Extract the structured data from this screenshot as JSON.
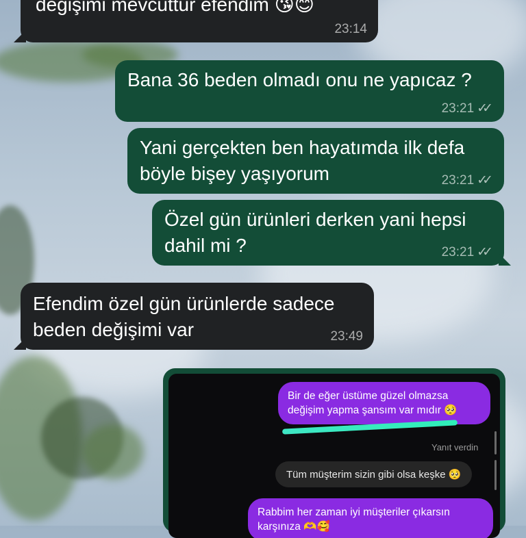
{
  "messages": [
    {
      "text": "değişimi mevcuttur efendim 😘😊",
      "time": "23:14"
    },
    {
      "text": "Bana 36 beden olmadı onu ne yapıcaz ?",
      "time": "23:21",
      "ticks": "✓✓"
    },
    {
      "text": "Yani gerçekten ben hayatımda ilk defa\nböyle bişey yaşıyorum",
      "time": "23:21",
      "ticks": "✓✓"
    },
    {
      "text": "Özel gün ürünleri derken yani hepsi\ndahil mi ?",
      "time": "23:21",
      "ticks": "✓✓"
    },
    {
      "text": "Efendim özel gün ürünlerde sadece\nbeden değişimi var",
      "time": "23:49"
    }
  ],
  "screenshot": {
    "bubble1": "Bir de eğer üstüme güzel olmazsa\ndeğişim yapma şansım var mıdır 🥺",
    "replied": "Yanıt verdin",
    "reply": "Tüm müşterim sizin gibi olsa keşke 🥺",
    "bubble2": "Rabbim her zaman iyi müşteriler çıkarsın\nkarşınıza 🫶🥰"
  },
  "colors": {
    "outgoing_bubble": "#134d37",
    "incoming_bubble": "#202224",
    "ig_sent_bubble": "#8a2be2",
    "highlight": "#3fe6c4"
  }
}
